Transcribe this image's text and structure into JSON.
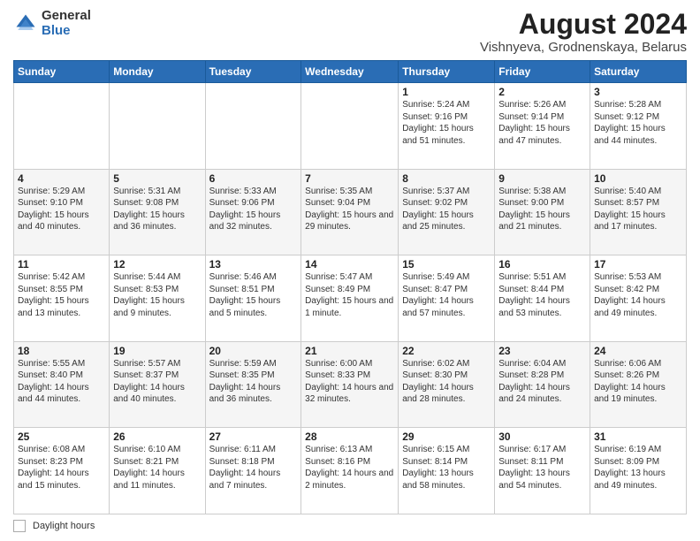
{
  "logo": {
    "general": "General",
    "blue": "Blue"
  },
  "title": "August 2024",
  "subtitle": "Vishnyeva, Grodnenskaya, Belarus",
  "weekdays": [
    "Sunday",
    "Monday",
    "Tuesday",
    "Wednesday",
    "Thursday",
    "Friday",
    "Saturday"
  ],
  "weeks": [
    [
      {
        "day": "",
        "info": ""
      },
      {
        "day": "",
        "info": ""
      },
      {
        "day": "",
        "info": ""
      },
      {
        "day": "",
        "info": ""
      },
      {
        "day": "1",
        "info": "Sunrise: 5:24 AM\nSunset: 9:16 PM\nDaylight: 15 hours and 51 minutes."
      },
      {
        "day": "2",
        "info": "Sunrise: 5:26 AM\nSunset: 9:14 PM\nDaylight: 15 hours and 47 minutes."
      },
      {
        "day": "3",
        "info": "Sunrise: 5:28 AM\nSunset: 9:12 PM\nDaylight: 15 hours and 44 minutes."
      }
    ],
    [
      {
        "day": "4",
        "info": "Sunrise: 5:29 AM\nSunset: 9:10 PM\nDaylight: 15 hours and 40 minutes."
      },
      {
        "day": "5",
        "info": "Sunrise: 5:31 AM\nSunset: 9:08 PM\nDaylight: 15 hours and 36 minutes."
      },
      {
        "day": "6",
        "info": "Sunrise: 5:33 AM\nSunset: 9:06 PM\nDaylight: 15 hours and 32 minutes."
      },
      {
        "day": "7",
        "info": "Sunrise: 5:35 AM\nSunset: 9:04 PM\nDaylight: 15 hours and 29 minutes."
      },
      {
        "day": "8",
        "info": "Sunrise: 5:37 AM\nSunset: 9:02 PM\nDaylight: 15 hours and 25 minutes."
      },
      {
        "day": "9",
        "info": "Sunrise: 5:38 AM\nSunset: 9:00 PM\nDaylight: 15 hours and 21 minutes."
      },
      {
        "day": "10",
        "info": "Sunrise: 5:40 AM\nSunset: 8:57 PM\nDaylight: 15 hours and 17 minutes."
      }
    ],
    [
      {
        "day": "11",
        "info": "Sunrise: 5:42 AM\nSunset: 8:55 PM\nDaylight: 15 hours and 13 minutes."
      },
      {
        "day": "12",
        "info": "Sunrise: 5:44 AM\nSunset: 8:53 PM\nDaylight: 15 hours and 9 minutes."
      },
      {
        "day": "13",
        "info": "Sunrise: 5:46 AM\nSunset: 8:51 PM\nDaylight: 15 hours and 5 minutes."
      },
      {
        "day": "14",
        "info": "Sunrise: 5:47 AM\nSunset: 8:49 PM\nDaylight: 15 hours and 1 minute."
      },
      {
        "day": "15",
        "info": "Sunrise: 5:49 AM\nSunset: 8:47 PM\nDaylight: 14 hours and 57 minutes."
      },
      {
        "day": "16",
        "info": "Sunrise: 5:51 AM\nSunset: 8:44 PM\nDaylight: 14 hours and 53 minutes."
      },
      {
        "day": "17",
        "info": "Sunrise: 5:53 AM\nSunset: 8:42 PM\nDaylight: 14 hours and 49 minutes."
      }
    ],
    [
      {
        "day": "18",
        "info": "Sunrise: 5:55 AM\nSunset: 8:40 PM\nDaylight: 14 hours and 44 minutes."
      },
      {
        "day": "19",
        "info": "Sunrise: 5:57 AM\nSunset: 8:37 PM\nDaylight: 14 hours and 40 minutes."
      },
      {
        "day": "20",
        "info": "Sunrise: 5:59 AM\nSunset: 8:35 PM\nDaylight: 14 hours and 36 minutes."
      },
      {
        "day": "21",
        "info": "Sunrise: 6:00 AM\nSunset: 8:33 PM\nDaylight: 14 hours and 32 minutes."
      },
      {
        "day": "22",
        "info": "Sunrise: 6:02 AM\nSunset: 8:30 PM\nDaylight: 14 hours and 28 minutes."
      },
      {
        "day": "23",
        "info": "Sunrise: 6:04 AM\nSunset: 8:28 PM\nDaylight: 14 hours and 24 minutes."
      },
      {
        "day": "24",
        "info": "Sunrise: 6:06 AM\nSunset: 8:26 PM\nDaylight: 14 hours and 19 minutes."
      }
    ],
    [
      {
        "day": "25",
        "info": "Sunrise: 6:08 AM\nSunset: 8:23 PM\nDaylight: 14 hours and 15 minutes."
      },
      {
        "day": "26",
        "info": "Sunrise: 6:10 AM\nSunset: 8:21 PM\nDaylight: 14 hours and 11 minutes."
      },
      {
        "day": "27",
        "info": "Sunrise: 6:11 AM\nSunset: 8:18 PM\nDaylight: 14 hours and 7 minutes."
      },
      {
        "day": "28",
        "info": "Sunrise: 6:13 AM\nSunset: 8:16 PM\nDaylight: 14 hours and 2 minutes."
      },
      {
        "day": "29",
        "info": "Sunrise: 6:15 AM\nSunset: 8:14 PM\nDaylight: 13 hours and 58 minutes."
      },
      {
        "day": "30",
        "info": "Sunrise: 6:17 AM\nSunset: 8:11 PM\nDaylight: 13 hours and 54 minutes."
      },
      {
        "day": "31",
        "info": "Sunrise: 6:19 AM\nSunset: 8:09 PM\nDaylight: 13 hours and 49 minutes."
      }
    ]
  ],
  "footer": {
    "box_label": "Daylight hours"
  }
}
